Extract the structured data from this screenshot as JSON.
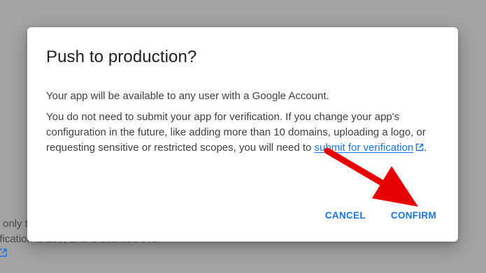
{
  "background": {
    "line1": "only t",
    "line2": "ification is 100, and is counted over"
  },
  "dialog": {
    "title": "Push to production?",
    "paragraph1": "Your app will be available to any user with a Google Account.",
    "paragraph2_text": "You do not need to submit your app for verification. If you change your app's configuration in the future, like adding more than 10 domains, uploading a logo, or requesting sensitive or restricted scopes, you will need to ",
    "link_label": "submit for verification",
    "paragraph2_end": ".",
    "cancel_label": "CANCEL",
    "confirm_label": "CONFIRM"
  },
  "icons": {
    "external_link": "external-link-icon",
    "annotation_arrow": "red-arrow"
  },
  "colors": {
    "accent": "#1a73e8",
    "annotation": "#e60000",
    "overlay": "#a3a3a3"
  }
}
